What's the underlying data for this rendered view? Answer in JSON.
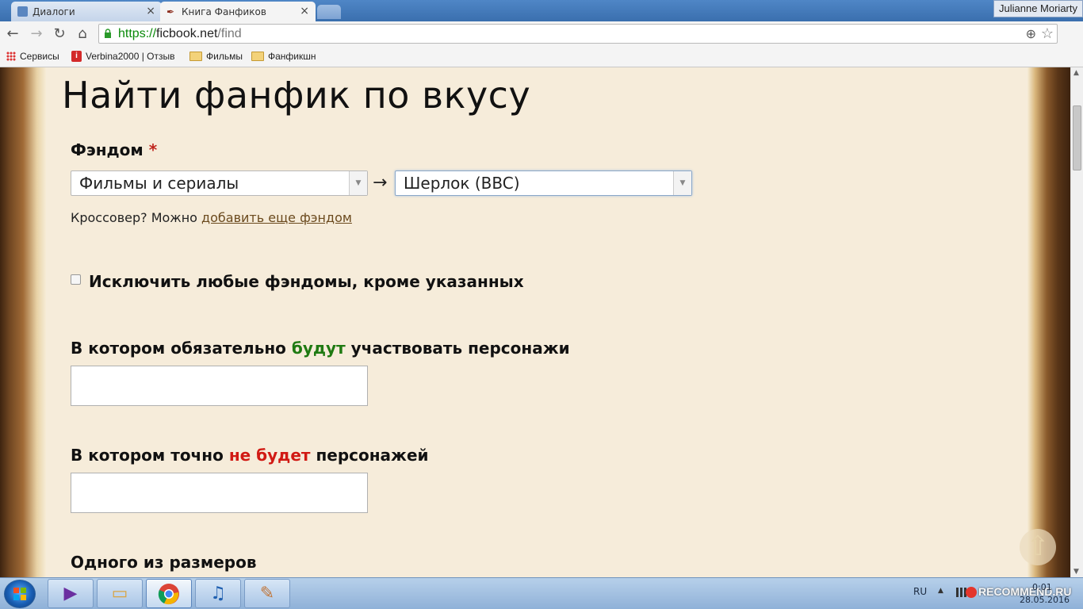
{
  "browser": {
    "tabs": [
      {
        "label": "Диалоги",
        "active": false
      },
      {
        "label": "Книга Фанфиков",
        "active": true
      }
    ],
    "close_glyph": "×",
    "user": "Julianne Moriarty",
    "url": {
      "scheme": "https://",
      "host": "ficbook.net",
      "path": "/find"
    },
    "bookmarks": [
      {
        "label": "Сервисы",
        "icon": "apps-icon"
      },
      {
        "label": "Verbina2000 | Отзыв",
        "icon": "irecommend-icon"
      },
      {
        "label": "Фильмы",
        "icon": "folder-icon"
      },
      {
        "label": "Фанфикшн",
        "icon": "folder-icon"
      }
    ]
  },
  "page": {
    "title": "Найти фанфик по вкусу",
    "fandom": {
      "label": "Фэндом",
      "required_mark": "*",
      "category_value": "Фильмы и сериалы",
      "fandom_value": "Шерлок (BBC)",
      "arrow": "→",
      "crossover_text": "Кроссовер? Можно",
      "crossover_link": "добавить еще фэндом"
    },
    "exclude_checkbox": {
      "label": "Исключить любые фэндомы, кроме указанных",
      "checked": false
    },
    "include_chars": {
      "before": "В котором обязательно",
      "highlight": "будут",
      "after": "участвовать персонажи",
      "value": ""
    },
    "exclude_chars": {
      "before": "В котором точно",
      "highlight": "не будет",
      "after": "персонажей",
      "value": ""
    },
    "size_label": "Одного из размеров"
  },
  "taskbar": {
    "language": "RU",
    "time": "0:01",
    "date": "28.05.2016",
    "watermark": "RECOMMEND.RU"
  },
  "colors": {
    "accent_green": "#1f7a12",
    "accent_red": "#d11a14",
    "paper": "#f6ecda"
  }
}
